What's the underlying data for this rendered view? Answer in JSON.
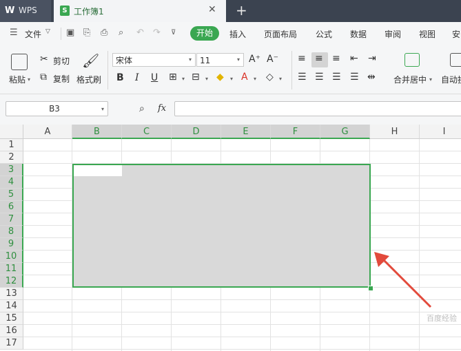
{
  "tabs": {
    "app_name": "WPS",
    "doc_name": "工作簿1",
    "doc_icon_letter": "S",
    "close": "✕",
    "new_tab": "+"
  },
  "menubar": {
    "file": "文件",
    "items": [
      "开始",
      "插入",
      "页面布局",
      "公式",
      "数据",
      "审阅",
      "视图",
      "安"
    ]
  },
  "ribbon": {
    "paste": "粘贴",
    "cut": "剪切",
    "copy": "复制",
    "format_painter": "格式刷",
    "font_name": "宋体",
    "font_size": "11",
    "grow_font": "A⁺",
    "shrink_font": "A⁻",
    "bold": "B",
    "italic": "I",
    "underline": "U",
    "merge_center": "合并居中",
    "auto_wrap": "自动换"
  },
  "formula_bar": {
    "name_box": "B3",
    "fx": "fx",
    "formula": ""
  },
  "sheet": {
    "columns": [
      "A",
      "B",
      "C",
      "D",
      "E",
      "F",
      "G",
      "H",
      "I"
    ],
    "rows": [
      "1",
      "2",
      "3",
      "4",
      "5",
      "6",
      "7",
      "8",
      "9",
      "10",
      "11",
      "12",
      "13",
      "14",
      "15",
      "16",
      "17"
    ],
    "selected_columns": [
      "B",
      "C",
      "D",
      "E",
      "F",
      "G"
    ],
    "selected_rows": [
      "3",
      "4",
      "5",
      "6",
      "7",
      "8",
      "9",
      "10",
      "11",
      "12"
    ],
    "selection_range": "B3:G12",
    "accent_color": "#3aa751",
    "arrow_color": "#e24a3c"
  },
  "watermark": "百度经验"
}
